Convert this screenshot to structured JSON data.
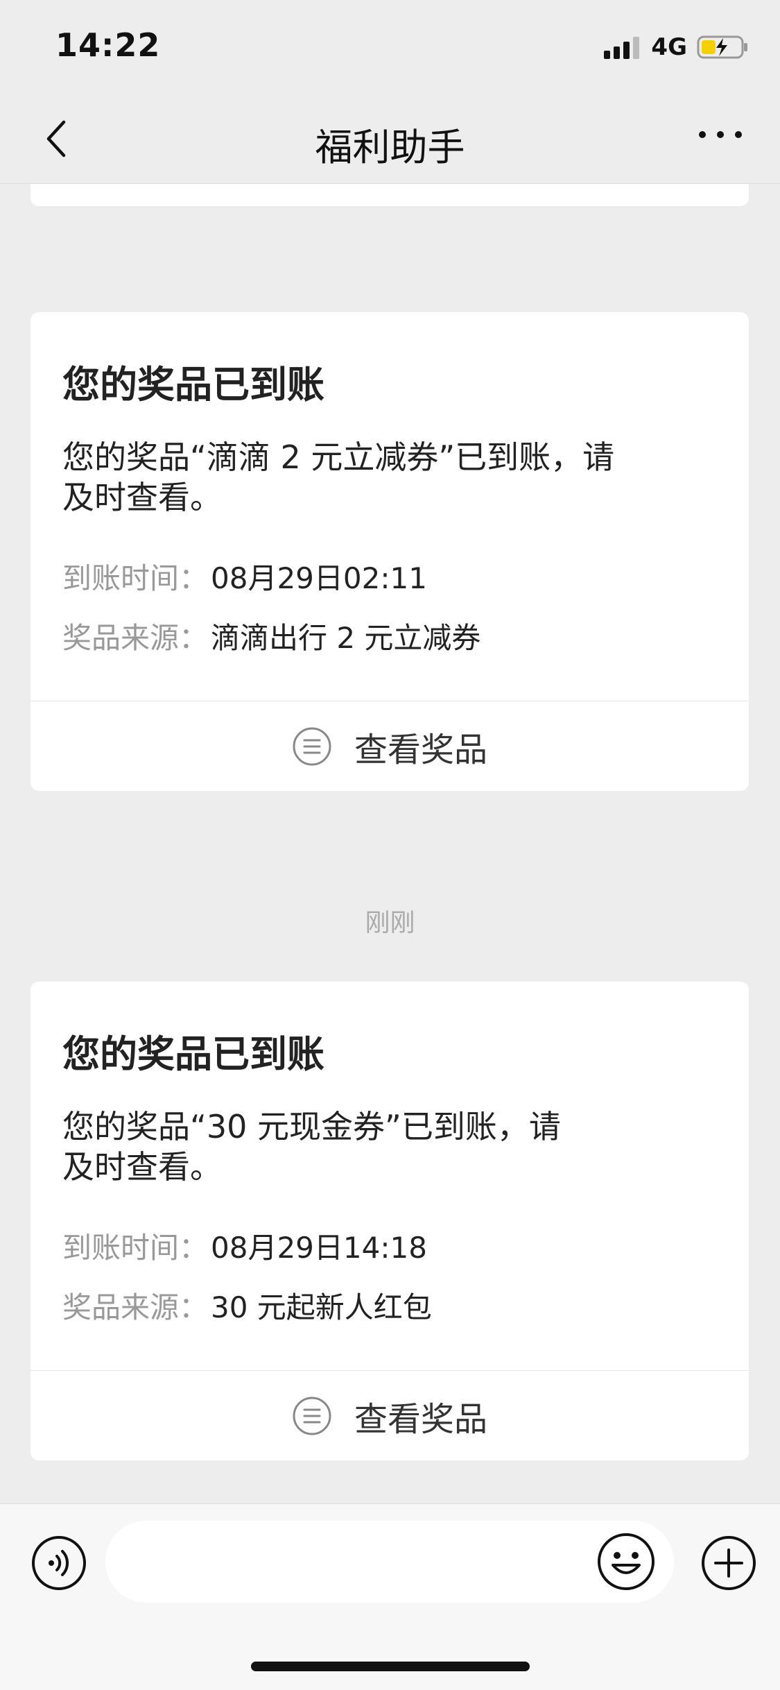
{
  "status": {
    "time": "14:22",
    "network": "4G",
    "signal_icon": "signal-bars-icon",
    "battery_icon": "battery-charging-icon",
    "battery_color": "#f5d100"
  },
  "nav": {
    "title": "福利助手",
    "back_icon": "chevron-left-icon",
    "more_icon": "more-dots-icon"
  },
  "messages": [
    {
      "title": "您的奖品已到账",
      "body_line1": "您的奖品“滴滴 2 元立减券”已到账，请",
      "body_line2": "及时查看。",
      "time_label": "到账时间：",
      "time_value": "08月29日02:11",
      "source_label": "奖品来源：",
      "source_value": "滴滴出行 2 元立减券",
      "action_label": "查看奖品"
    },
    {
      "timestamp": "刚刚",
      "title": "您的奖品已到账",
      "body_line1": "您的奖品“30 元现金券”已到账，请",
      "body_line2": "及时查看。",
      "time_label": "到账时间：",
      "time_value": "08月29日14:18",
      "source_label": "奖品来源：",
      "source_value": "30 元起新人红包",
      "action_label": "查看奖品"
    }
  ],
  "input_bar": {
    "voice_icon": "voice-icon",
    "emoji_icon": "emoji-icon",
    "plus_icon": "plus-icon",
    "placeholder": ""
  }
}
